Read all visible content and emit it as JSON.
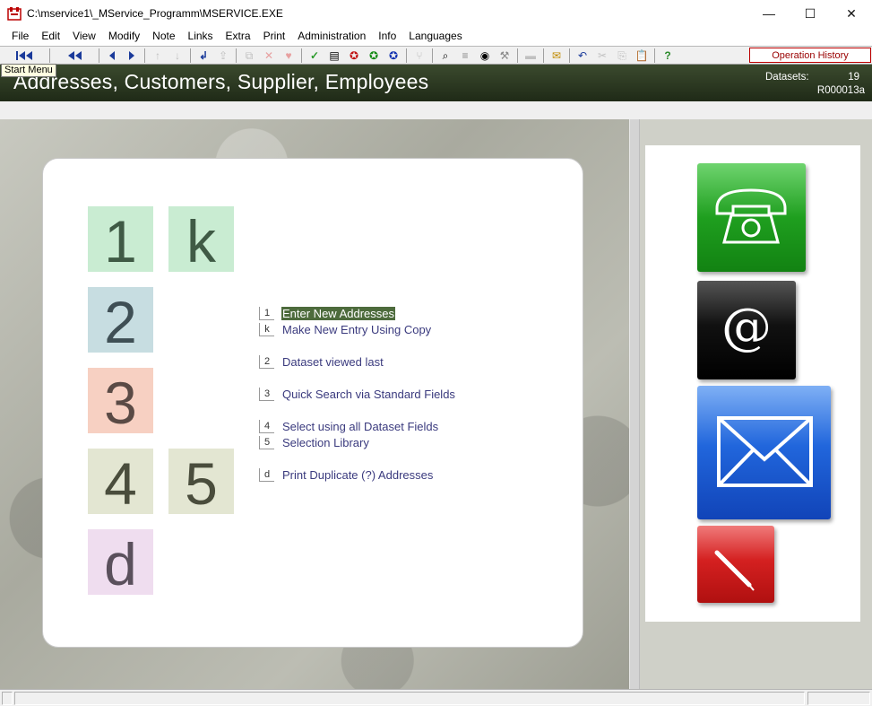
{
  "window": {
    "title": "C:\\mservice1\\_MService_Programm\\MSERVICE.EXE",
    "minimize": "—",
    "maximize": "☐",
    "close": "✕"
  },
  "menu": [
    "File",
    "Edit",
    "View",
    "Modify",
    "Note",
    "Links",
    "Extra",
    "Print",
    "Administration",
    "Info",
    "Languages"
  ],
  "toolbar": {
    "operation_history": "Operation History",
    "start_menu_tip": "Start Menu"
  },
  "banner": {
    "title": "Addresses, Customers, Supplier, Employees",
    "datasets_label": "Datasets:",
    "datasets_count": "19",
    "record_code": "R000013a"
  },
  "tiles": [
    {
      "key": "1",
      "bg": "#c9ecd2",
      "fg": "#3f5a45"
    },
    {
      "key": "k",
      "bg": "#c9ecd2",
      "fg": "#3f5a45"
    },
    {
      "key": "2",
      "bg": "#c7dde1",
      "fg": "#3f4f55"
    },
    {
      "key": "3",
      "bg": "#f7d0c2",
      "fg": "#5a4a45"
    },
    {
      "key": "4",
      "bg": "#e3e6d2",
      "fg": "#4a4d3c"
    },
    {
      "key": "5",
      "bg": "#e3e6d2",
      "fg": "#4a4d3c"
    },
    {
      "key": "d",
      "bg": "#efddef",
      "fg": "#5a505c"
    }
  ],
  "options": [
    {
      "key": "1",
      "label": "Enter New Addresses",
      "selected": true
    },
    {
      "key": "k",
      "label": "Make New Entry Using Copy"
    },
    {
      "key": "2",
      "label": "Dataset viewed last"
    },
    {
      "key": "3",
      "label": "Quick Search via Standard Fields"
    },
    {
      "key": "4",
      "label": "Select using all Dataset Fields"
    },
    {
      "key": "5",
      "label": "Selection Library"
    },
    {
      "key": "d",
      "label": "Print Duplicate (?) Addresses"
    }
  ],
  "right_icons": [
    {
      "name": "phone-icon",
      "color": "#2ea82e"
    },
    {
      "name": "email-at-icon",
      "color": "#111111"
    },
    {
      "name": "mail-envelope-icon",
      "color": "#1f5fd0"
    },
    {
      "name": "pen-note-icon",
      "color": "#d42020"
    }
  ],
  "colors": {
    "banner": "#2a3620",
    "selection": "#4d6b3c",
    "option_text": "#3a3a7e"
  }
}
